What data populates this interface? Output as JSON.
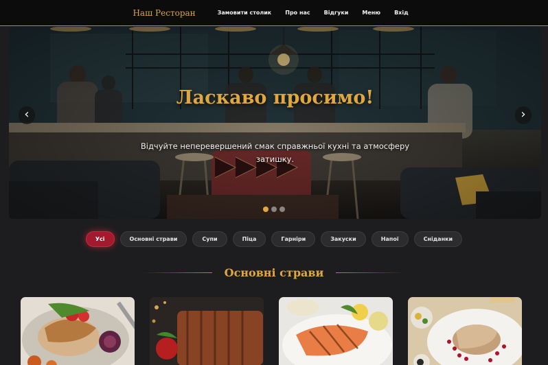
{
  "nav": {
    "brand": "Наш Ресторан",
    "items": [
      {
        "label": "Замовити столик"
      },
      {
        "label": "Про нас"
      },
      {
        "label": "Відгуки"
      },
      {
        "label": "Меню"
      },
      {
        "label": "Вхід"
      }
    ]
  },
  "hero": {
    "title": "Ласкаво просимо!",
    "subtitle": "Відчуйте неперевершений смак справжньої кухні та атмосферу затишку.",
    "prev_icon": "‹",
    "next_icon": "›",
    "slide_count": 3,
    "active_slide": 1
  },
  "filters": [
    {
      "label": "Усі",
      "active": true
    },
    {
      "label": "Основні страви"
    },
    {
      "label": "Супи"
    },
    {
      "label": "Піца"
    },
    {
      "label": "Гарніри"
    },
    {
      "label": "Закуски"
    },
    {
      "label": "Напої"
    },
    {
      "label": "Сніданки"
    }
  ],
  "section": {
    "title": "Основні страви"
  },
  "dishes": [
    {
      "icon": "grilled-chicken-plate-image"
    },
    {
      "icon": "bbq-ribs-image"
    },
    {
      "icon": "grilled-salmon-image"
    },
    {
      "icon": "pork-steak-pomegranate-image"
    }
  ],
  "colors": {
    "accent_gold": "#e0a83c",
    "active_chip": "#a3192d",
    "background": "#1d1d1f"
  }
}
